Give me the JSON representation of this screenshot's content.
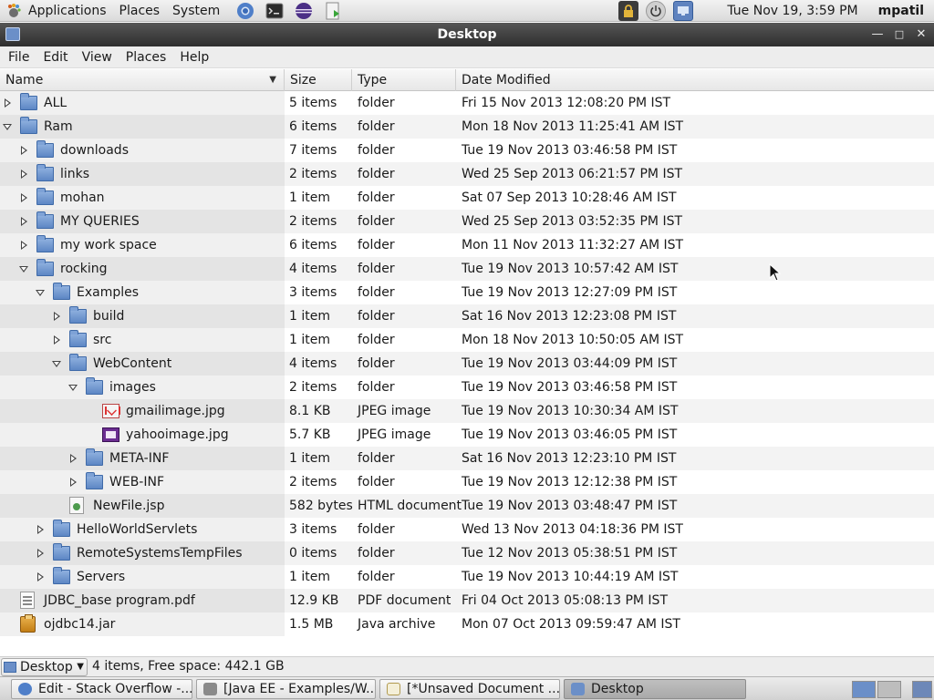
{
  "top_panel": {
    "menus": [
      "Applications",
      "Places",
      "System"
    ],
    "clock": "Tue Nov 19,  3:59 PM",
    "user": "mpatil",
    "launchers": [
      "chrome-icon",
      "terminal-icon",
      "eclipse-icon",
      "package-installer-icon"
    ],
    "tray": [
      "lock-screen-icon",
      "power-icon",
      "network-icon"
    ]
  },
  "window": {
    "title": "Desktop"
  },
  "menubar": {
    "items": [
      "File",
      "Edit",
      "View",
      "Places",
      "Help"
    ]
  },
  "columns": {
    "name": "Name",
    "size": "Size",
    "type": "Type",
    "date": "Date Modified"
  },
  "rows": [
    {
      "name": "ALL",
      "size": "5 items",
      "type": "folder",
      "date": "Fri 15 Nov 2013 12:08:20 PM IST",
      "expander": "closed",
      "icon": "folder-icon"
    },
    {
      "name": "Ram",
      "size": "6 items",
      "type": "folder",
      "date": "Mon 18 Nov 2013 11:25:41 AM IST",
      "expander": "open",
      "icon": "folder-icon"
    },
    {
      "name": "downloads",
      "size": "7 items",
      "type": "folder",
      "date": "Tue 19 Nov 2013 03:46:58 PM IST",
      "expander": "closed",
      "icon": "folder-icon"
    },
    {
      "name": "links",
      "size": "2 items",
      "type": "folder",
      "date": "Wed 25 Sep 2013 06:21:57 PM IST",
      "expander": "closed",
      "icon": "folder-icon"
    },
    {
      "name": "mohan",
      "size": "1 item",
      "type": "folder",
      "date": "Sat 07 Sep 2013 10:28:46 AM IST",
      "expander": "closed",
      "icon": "folder-icon"
    },
    {
      "name": "MY QUERIES",
      "size": "2 items",
      "type": "folder",
      "date": "Wed 25 Sep 2013 03:52:35 PM IST",
      "expander": "closed",
      "icon": "folder-icon"
    },
    {
      "name": "my work space",
      "size": "6 items",
      "type": "folder",
      "date": "Mon 11 Nov 2013 11:32:27 AM IST",
      "expander": "closed",
      "icon": "folder-icon"
    },
    {
      "name": "rocking",
      "size": "4 items",
      "type": "folder",
      "date": "Tue 19 Nov 2013 10:57:42 AM IST",
      "expander": "open",
      "icon": "folder-icon"
    },
    {
      "name": "Examples",
      "size": "3 items",
      "type": "folder",
      "date": "Tue 19 Nov 2013 12:27:09 PM IST",
      "expander": "open",
      "icon": "folder-icon"
    },
    {
      "name": "build",
      "size": "1 item",
      "type": "folder",
      "date": "Sat 16 Nov 2013 12:23:08 PM IST",
      "expander": "closed",
      "icon": "folder-icon"
    },
    {
      "name": "src",
      "size": "1 item",
      "type": "folder",
      "date": "Mon 18 Nov 2013 10:50:05 AM IST",
      "expander": "closed",
      "icon": "folder-icon"
    },
    {
      "name": "WebContent",
      "size": "4 items",
      "type": "folder",
      "date": "Tue 19 Nov 2013 03:44:09 PM IST",
      "expander": "open",
      "icon": "folder-icon"
    },
    {
      "name": "images",
      "size": "2 items",
      "type": "folder",
      "date": "Tue 19 Nov 2013 03:46:58 PM IST",
      "expander": "open",
      "icon": "folder-icon"
    },
    {
      "name": "gmailimage.jpg",
      "size": "8.1 KB",
      "type": "JPEG image",
      "date": "Tue 19 Nov 2013 10:30:34 AM IST",
      "expander": "none",
      "icon": "gmail-image-icon"
    },
    {
      "name": "yahooimage.jpg",
      "size": "5.7 KB",
      "type": "JPEG image",
      "date": "Tue 19 Nov 2013 03:46:05 PM IST",
      "expander": "none",
      "icon": "yahoo-image-icon"
    },
    {
      "name": "META-INF",
      "size": "1 item",
      "type": "folder",
      "date": "Sat 16 Nov 2013 12:23:10 PM IST",
      "expander": "closed",
      "icon": "folder-icon"
    },
    {
      "name": "WEB-INF",
      "size": "2 items",
      "type": "folder",
      "date": "Tue 19 Nov 2013 12:12:38 PM IST",
      "expander": "closed",
      "icon": "folder-icon"
    },
    {
      "name": "NewFile.jsp",
      "size": "582 bytes",
      "type": "HTML document",
      "date": "Tue 19 Nov 2013 03:48:47 PM IST",
      "expander": "none",
      "icon": "jsp-file-icon"
    },
    {
      "name": "HelloWorldServlets",
      "size": "3 items",
      "type": "folder",
      "date": "Wed 13 Nov 2013 04:18:36 PM IST",
      "expander": "closed",
      "icon": "folder-icon"
    },
    {
      "name": "RemoteSystemsTempFiles",
      "size": "0 items",
      "type": "folder",
      "date": "Tue 12 Nov 2013 05:38:51 PM IST",
      "expander": "closed",
      "icon": "folder-icon"
    },
    {
      "name": "Servers",
      "size": "1 item",
      "type": "folder",
      "date": "Tue 19 Nov 2013 10:44:19 AM IST",
      "expander": "closed",
      "icon": "folder-icon"
    },
    {
      "name": "JDBC_base program.pdf",
      "size": "12.9 KB",
      "type": "PDF document",
      "date": "Fri 04 Oct 2013 05:08:13 PM IST",
      "expander": "none",
      "icon": "pdf-file-icon"
    },
    {
      "name": "ojdbc14.jar",
      "size": "1.5 MB",
      "type": "Java archive",
      "date": "Mon 07 Oct 2013 09:59:47 AM IST",
      "expander": "none",
      "icon": "jar-file-icon"
    }
  ],
  "statusbar": {
    "place": "Desktop",
    "status": "4 items, Free space: 442.1 GB"
  },
  "taskbar": {
    "tasks": [
      {
        "label": "Edit - Stack Overflow -...",
        "icon": "chrome-icon",
        "active": false
      },
      {
        "label": "[Java EE - Examples/W...",
        "icon": "eclipse-icon",
        "active": false
      },
      {
        "label": "[*Unsaved Document ...",
        "icon": "text-editor-icon",
        "active": false
      },
      {
        "label": "Desktop",
        "icon": "folder-window-icon",
        "active": true
      }
    ]
  },
  "colors": {
    "titlebar": "#3a3a3a",
    "folder": "#6b8fc8",
    "row_alt": "#e4e4e4"
  }
}
